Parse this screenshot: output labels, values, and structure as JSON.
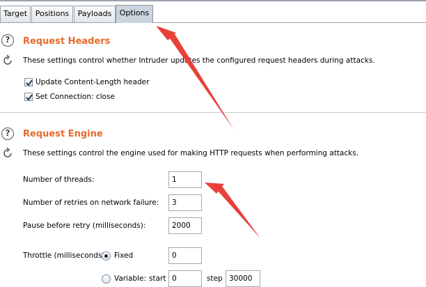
{
  "tabs": [
    {
      "label": "Target",
      "active": false
    },
    {
      "label": "Positions",
      "active": false
    },
    {
      "label": "Payloads",
      "active": false
    },
    {
      "label": "Options",
      "active": true
    }
  ],
  "request_headers": {
    "title": "Request Headers",
    "description": "These settings control whether Intruder updates the configured request headers during attacks.",
    "options": [
      {
        "label": "Update Content-Length header",
        "checked": true
      },
      {
        "label": "Set Connection: close",
        "checked": true
      }
    ]
  },
  "request_engine": {
    "title": "Request Engine",
    "description": "These settings control the engine used for making HTTP requests when performing attacks.",
    "threads_label": "Number of threads:",
    "threads_value": "1",
    "retries_label": "Number of retries on network failure:",
    "retries_value": "3",
    "pause_label": "Pause before retry (milliseconds):",
    "pause_value": "2000",
    "throttle_label": "Throttle (milliseconds):",
    "fixed_label": "Fixed",
    "fixed_selected": true,
    "fixed_value": "0",
    "variable_label": "Variable:",
    "variable_selected": false,
    "start_label": "start",
    "start_value": "0",
    "step_label": "step",
    "step_value": "30000"
  },
  "colors": {
    "section_title": "#e8692a",
    "annotation_arrow": "#e8413a",
    "active_tab": "#c9d4de"
  },
  "icons": [
    "help-icon",
    "refresh-icon",
    "checkmark-icon",
    "radio-dot-icon",
    "arrow-annotation"
  ]
}
